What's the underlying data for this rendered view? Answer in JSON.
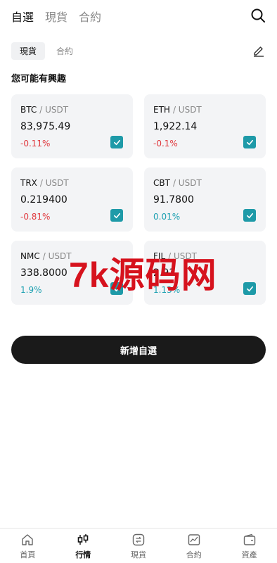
{
  "top_tabs": [
    "自選",
    "現貨",
    "合約"
  ],
  "sub_tabs": [
    "現貨",
    "合約"
  ],
  "section_title": "您可能有興趣",
  "cards": [
    {
      "base": "BTC",
      "quote": "/ USDT",
      "price": "83,975.49",
      "change": "-0.11%",
      "direction": "neg",
      "checked": true
    },
    {
      "base": "ETH",
      "quote": "/ USDT",
      "price": "1,922.14",
      "change": "-0.1%",
      "direction": "neg",
      "checked": true
    },
    {
      "base": "TRX",
      "quote": "/ USDT",
      "price": "0.219400",
      "change": "-0.81%",
      "direction": "neg",
      "checked": true
    },
    {
      "base": "CBT",
      "quote": "/ USDT",
      "price": "91.7800",
      "change": "0.01%",
      "direction": "pos",
      "checked": true
    },
    {
      "base": "NMC",
      "quote": "/ USDT",
      "price": "338.8000",
      "change": "1.9%",
      "direction": "pos",
      "checked": true
    },
    {
      "base": "FIL",
      "quote": "/ USDT",
      "price": "2.93",
      "change": "1.13%",
      "direction": "pos",
      "checked": true
    }
  ],
  "add_button": "新增自選",
  "watermark": "7k源码网",
  "nav": [
    {
      "label": "首頁",
      "icon": "home-icon"
    },
    {
      "label": "行情",
      "icon": "candlestick-icon"
    },
    {
      "label": "現貨",
      "icon": "swap-icon"
    },
    {
      "label": "合約",
      "icon": "contract-chart-icon"
    },
    {
      "label": "資產",
      "icon": "wallet-icon"
    }
  ],
  "colors": {
    "accent": "#1e9aa8",
    "negative": "#e0393e",
    "positive": "#1a9fb0",
    "button": "#1a1a1a",
    "card_bg": "#f3f4f6"
  }
}
